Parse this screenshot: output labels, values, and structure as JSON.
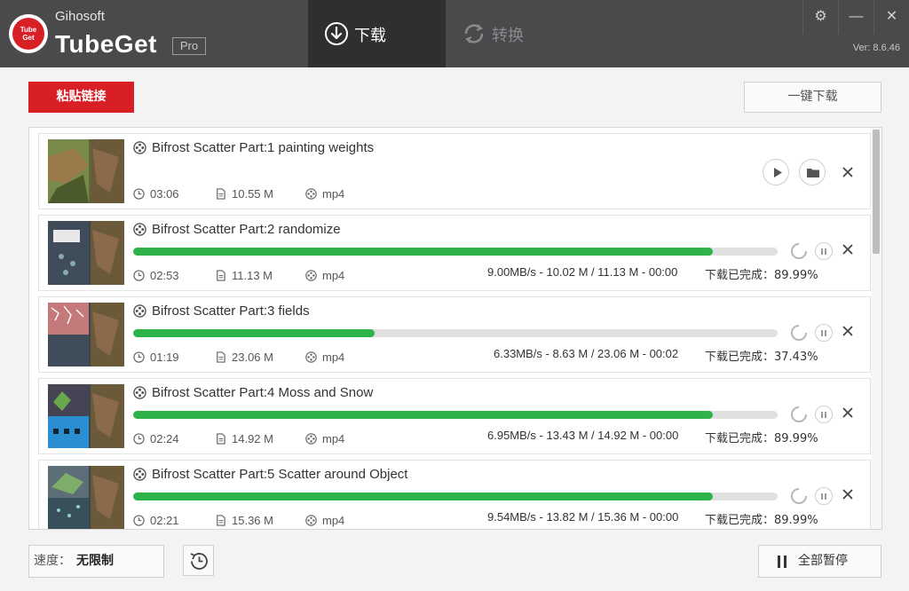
{
  "app": {
    "brand_small": "Gihosoft",
    "brand_big": "TubeGet",
    "badge": "Pro",
    "logo_text_top": "Tube",
    "logo_text_bottom": "Get",
    "version": "Ver: 8.6.46",
    "accent_color": "#d91f26",
    "progress_color": "#2eb34a"
  },
  "tabs": [
    {
      "label": "下载",
      "icon": "download-circle-icon",
      "active": true
    },
    {
      "label": "转换",
      "icon": "convert-sync-icon",
      "active": false
    }
  ],
  "window_controls": {
    "settings": "⚙",
    "minimize": "—",
    "close": "✕"
  },
  "toolbar": {
    "paste_label": "粘贴链接",
    "one_click_label": "一键下载"
  },
  "items": [
    {
      "title": "Bifrost Scatter Part:1 painting weights",
      "duration": "03:06",
      "size": "10.55 M",
      "format": "mp4",
      "status": "completed"
    },
    {
      "title": "Bifrost Scatter Part:2 randomize",
      "duration": "02:53",
      "size": "11.13 M",
      "format": "mp4",
      "status": "downloading",
      "progress": 0.8999,
      "speed_text": "9.00MB/s - 10.02 M / 11.13 M - 00:00",
      "done_text": "下载已完成：89.99%"
    },
    {
      "title": "Bifrost Scatter Part:3 fields",
      "duration": "01:19",
      "size": "23.06 M",
      "format": "mp4",
      "status": "downloading",
      "progress": 0.3743,
      "speed_text": "6.33MB/s - 8.63 M / 23.06 M - 00:02",
      "done_text": "下载已完成：37.43%"
    },
    {
      "title": "Bifrost Scatter Part:4 Moss and Snow",
      "duration": "02:24",
      "size": "14.92 M",
      "format": "mp4",
      "status": "downloading",
      "progress": 0.8999,
      "speed_text": "6.95MB/s - 13.43 M / 14.92 M - 00:00",
      "done_text": "下载已完成：89.99%"
    },
    {
      "title": "Bifrost Scatter Part:5 Scatter around Object",
      "duration": "02:21",
      "size": "15.36 M",
      "format": "mp4",
      "status": "downloading",
      "progress": 0.8999,
      "speed_text": "9.54MB/s - 13.82 M / 15.36 M - 00:00",
      "done_text": "下载已完成：89.99%"
    }
  ],
  "bottom": {
    "speed_label": "速度：",
    "speed_value": "无限制",
    "pause_all_label": "全部暂停"
  }
}
